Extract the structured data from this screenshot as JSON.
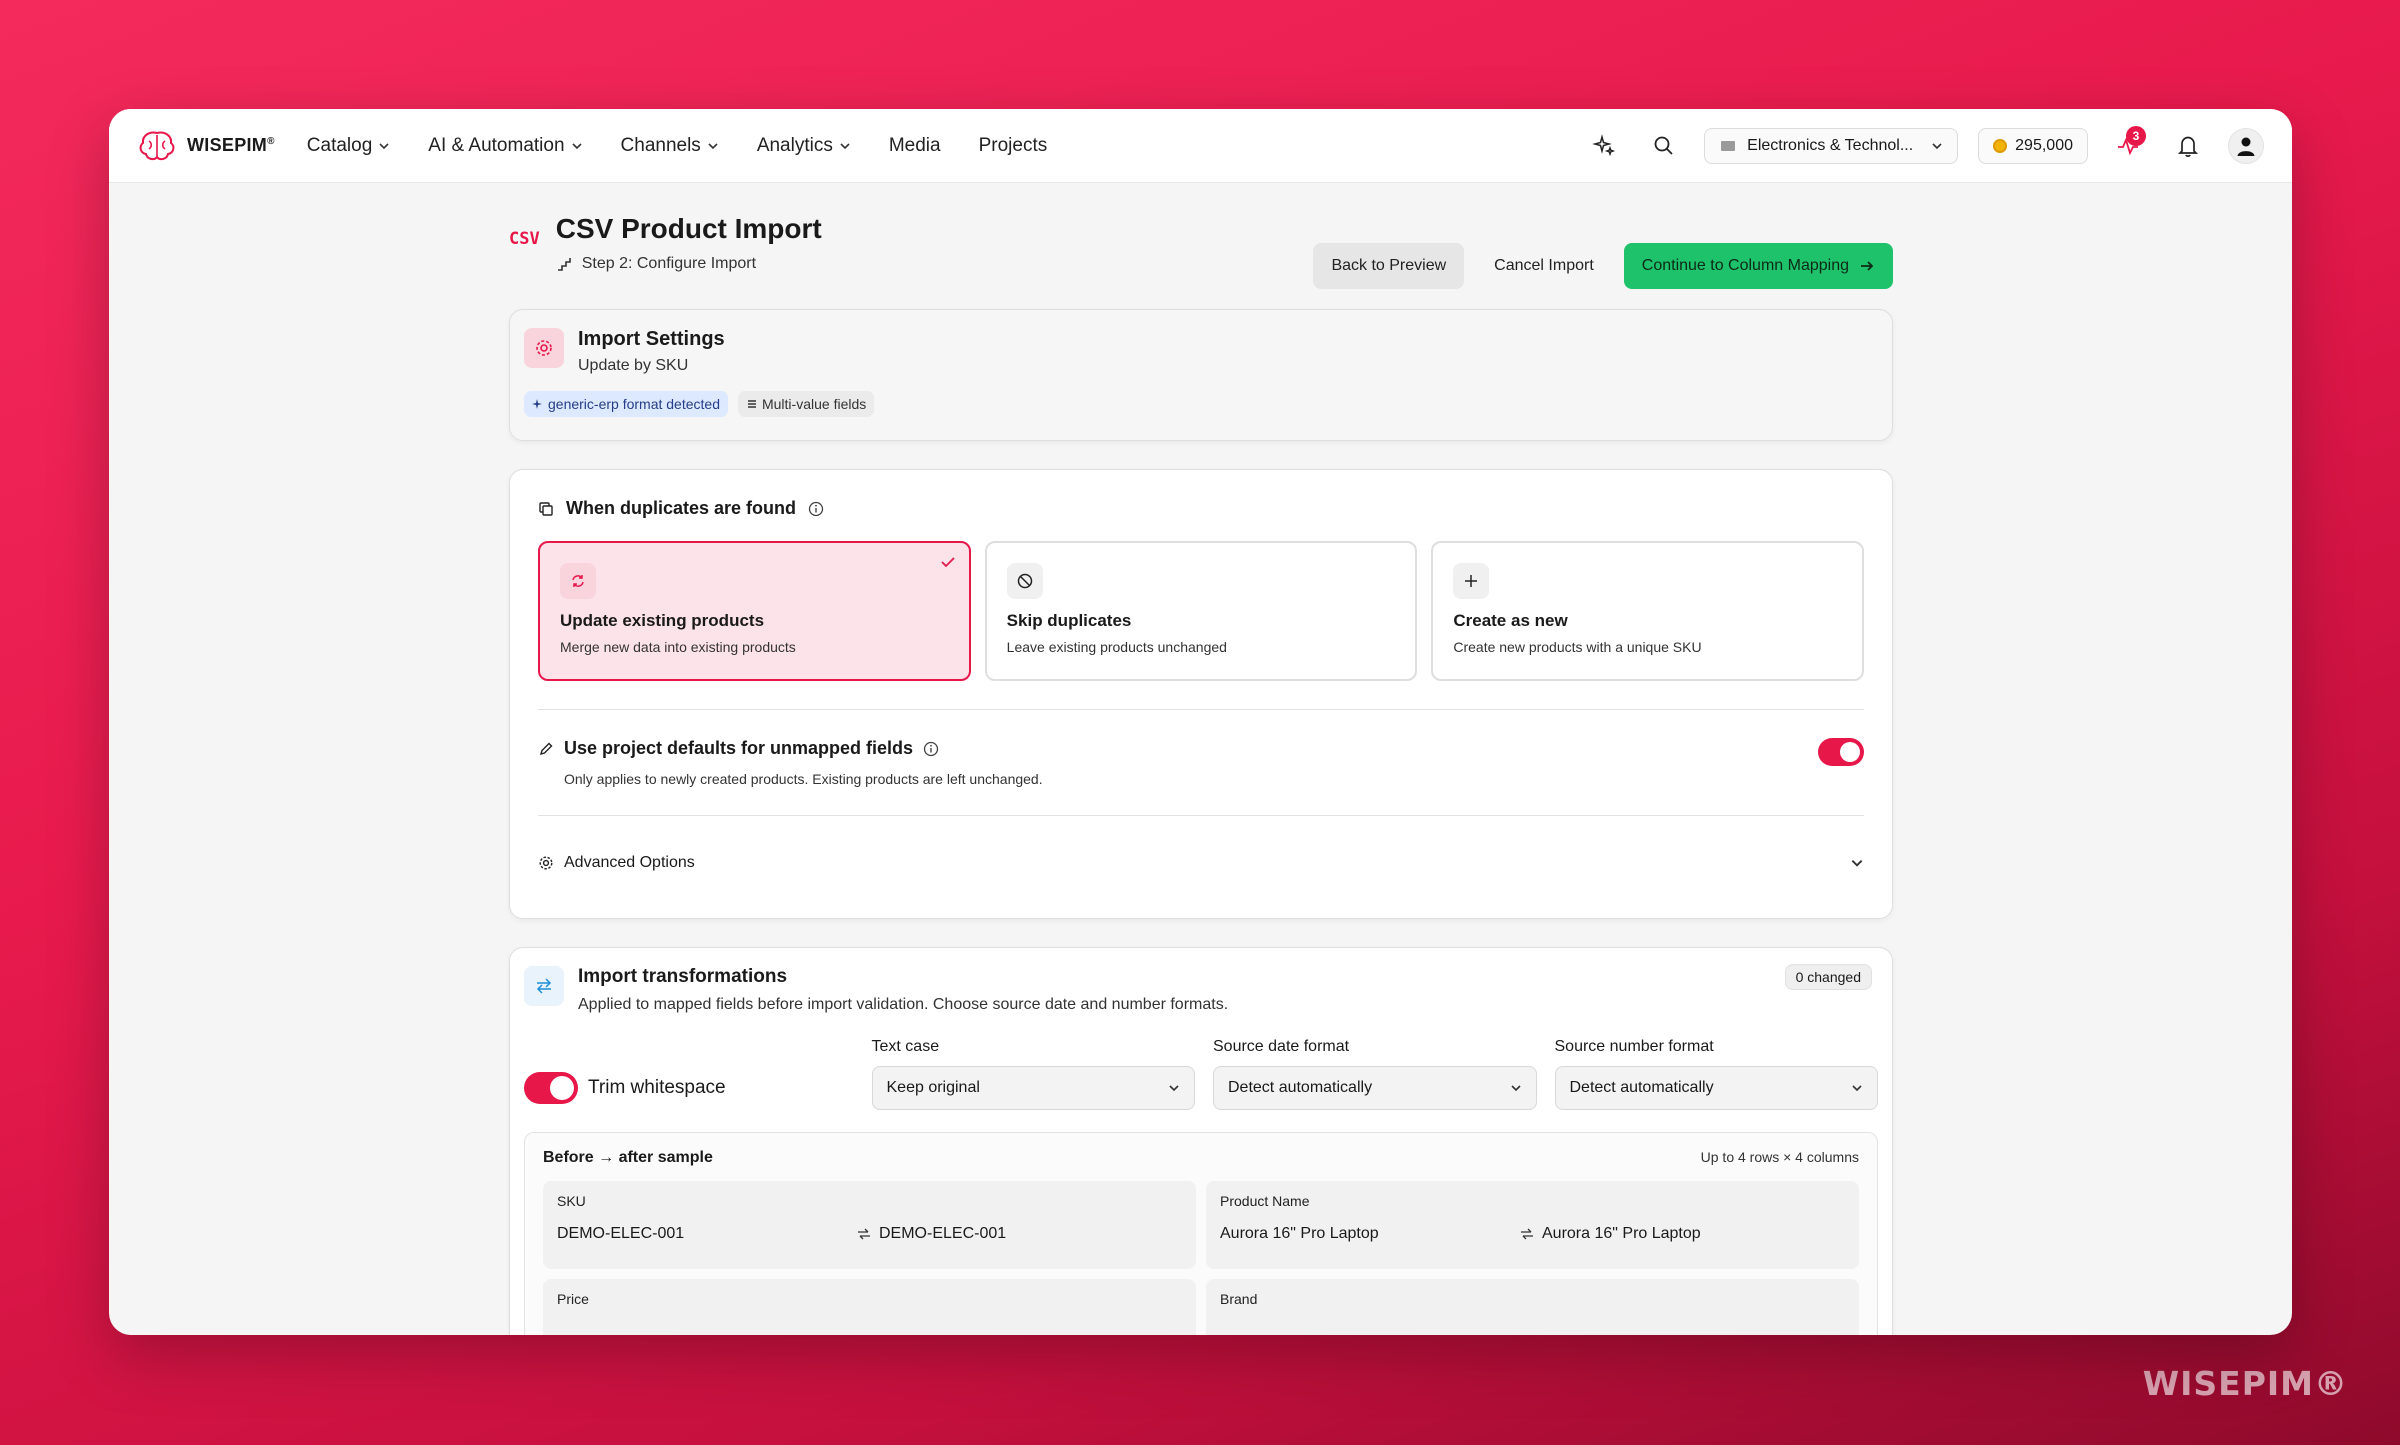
{
  "brand": {
    "name": "WISEPIM",
    "mark": "®",
    "watermark": "WISEPIM®"
  },
  "nav": {
    "items": [
      {
        "label": "Catalog",
        "dropdown": true
      },
      {
        "label": "AI & Automation",
        "dropdown": true
      },
      {
        "label": "Channels",
        "dropdown": true
      },
      {
        "label": "Analytics",
        "dropdown": true
      },
      {
        "label": "Media",
        "dropdown": false
      },
      {
        "label": "Projects",
        "dropdown": false
      }
    ],
    "workspace": "Electronics & Technol...",
    "credits": "295,000",
    "activity_badge": "3"
  },
  "page": {
    "csv_mark": "CSV",
    "title": "CSV Product Import",
    "step": "Step 2: Configure Import",
    "actions": {
      "back": "Back to Preview",
      "cancel": "Cancel Import",
      "continue": "Continue to Column Mapping"
    }
  },
  "settings": {
    "title": "Import Settings",
    "subtitle": "Update by SKU",
    "chips": [
      "generic-erp format detected",
      "Multi-value fields"
    ]
  },
  "duplicates": {
    "heading": "When duplicates are found",
    "options": [
      {
        "title": "Update existing products",
        "desc": "Merge new data into existing products",
        "selected": true,
        "icon": "refresh-icon"
      },
      {
        "title": "Skip duplicates",
        "desc": "Leave existing products unchanged",
        "selected": false,
        "icon": "ban-icon"
      },
      {
        "title": "Create as new",
        "desc": "Create new products with a unique SKU",
        "selected": false,
        "icon": "plus-icon"
      }
    ],
    "defaults_title": "Use project defaults for unmapped fields",
    "defaults_desc": "Only applies to newly created products. Existing products are left unchanged.",
    "defaults_on": true,
    "advanced": "Advanced Options"
  },
  "transformations": {
    "title": "Import transformations",
    "subtitle": "Applied to mapped fields before import validation. Choose source date and number formats.",
    "changed": "0 changed",
    "trim_label": "Trim whitespace",
    "trim_on": true,
    "fields": [
      {
        "label": "Text case",
        "value": "Keep original"
      },
      {
        "label": "Source date format",
        "value": "Detect automatically"
      },
      {
        "label": "Source number format",
        "value": "Detect automatically"
      }
    ],
    "sample": {
      "title": "Before → after sample",
      "meta": "Up to 4 rows × 4 columns",
      "cells": [
        {
          "label": "SKU",
          "before": "DEMO-ELEC-001",
          "after": "DEMO-ELEC-001"
        },
        {
          "label": "Product Name",
          "before": "Aurora 16\" Pro Laptop",
          "after": "Aurora 16\" Pro Laptop"
        },
        {
          "label": "Price",
          "before": "",
          "after": ""
        },
        {
          "label": "Brand",
          "before": "",
          "after": ""
        }
      ]
    }
  },
  "colors": {
    "accent": "#e8174a",
    "green": "#1ec26a",
    "background": "#f42a5c"
  }
}
